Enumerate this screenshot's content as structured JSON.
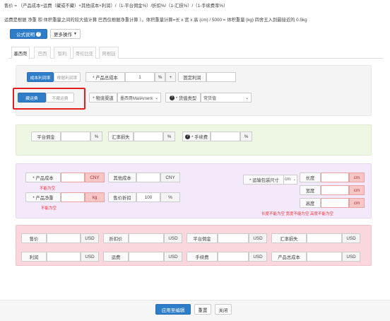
{
  "formula_line": "售价 = （产品成本+运费（藏或不藏）+其他成本+利润）/（1-平台佣金%）/折扣%/（1-汇损%）/（1-手续费率%）",
  "note_line": "运费是根据 净重 和 体积重量之间的较大值计算 巴西仅根据净重计算 ）。体积重量计算=长 x 宽 x 高 (cm) / 5000 = 体积重量 (kg) 四舍五入到最接近的 0.5kg",
  "toolbar": {
    "formula_btn": "公式说明",
    "formula_badge": "?",
    "more_btn": "更多操作"
  },
  "tabs": [
    {
      "label": "墨西哥"
    },
    {
      "label": "巴西"
    },
    {
      "label": "智利"
    },
    {
      "label": "哥伦比亚"
    },
    {
      "label": "阿根廷"
    }
  ],
  "sec1": {
    "mode_a": "成本利润率",
    "mode_b": "根据利润率",
    "cost_label": "* 产品总成本",
    "cost_value": "1",
    "cost_unit": "%",
    "plus": "+",
    "fixed_profit_label": "固定利润",
    "ship_a": "藏运费",
    "ship_b": "不藏运费",
    "logistics_label": "* 物流渠道",
    "logistics_value": "墨西哥MailAmerk",
    "goods_type_label": "* 货值类型",
    "goods_type_value": "常货值"
  },
  "sec2": {
    "platform_fee_label": "平台佣金",
    "platform_fee_unit": "%",
    "fx_loss_label": "汇率损失",
    "fx_loss_unit": "%",
    "handling_label": "* 手续费",
    "handling_unit": "%"
  },
  "sec3": {
    "product_cost_label": "* 产品成本",
    "product_cost_unit": "CNY",
    "product_cost_err": "不能为空",
    "other_cost_label": "其他成本",
    "other_cost_unit": "CNY",
    "net_weight_label": "* 产品净重",
    "net_weight_unit": "kg",
    "net_weight_err": "不能为空",
    "discount_label": "售价折扣",
    "discount_value": "100",
    "discount_unit": "%",
    "pkg_label": "* 运输包装尺寸",
    "pkg_unit_select": "cm",
    "length_label": "长度",
    "width_label": "宽度",
    "height_label": "高度",
    "dim_unit": "cm",
    "dim_err": "长度不能为空 宽度不能为空 高度不能为空"
  },
  "sec4": {
    "row1": [
      {
        "label": "售价",
        "unit": "USD"
      },
      {
        "label": "折扣价",
        "unit": "USD"
      },
      {
        "label": "平台佣金",
        "unit": "USD"
      },
      {
        "label": "汇率损失",
        "unit": "USD"
      }
    ],
    "row2": [
      {
        "label": "利润",
        "unit": "USD"
      },
      {
        "label": "运费",
        "unit": "USD"
      },
      {
        "label": "手续费",
        "unit": "USD"
      },
      {
        "label": "产品总成本",
        "unit": "USD"
      }
    ]
  },
  "footer": {
    "apply": "应用至编辑",
    "reset": "重置",
    "close": "关闭"
  }
}
